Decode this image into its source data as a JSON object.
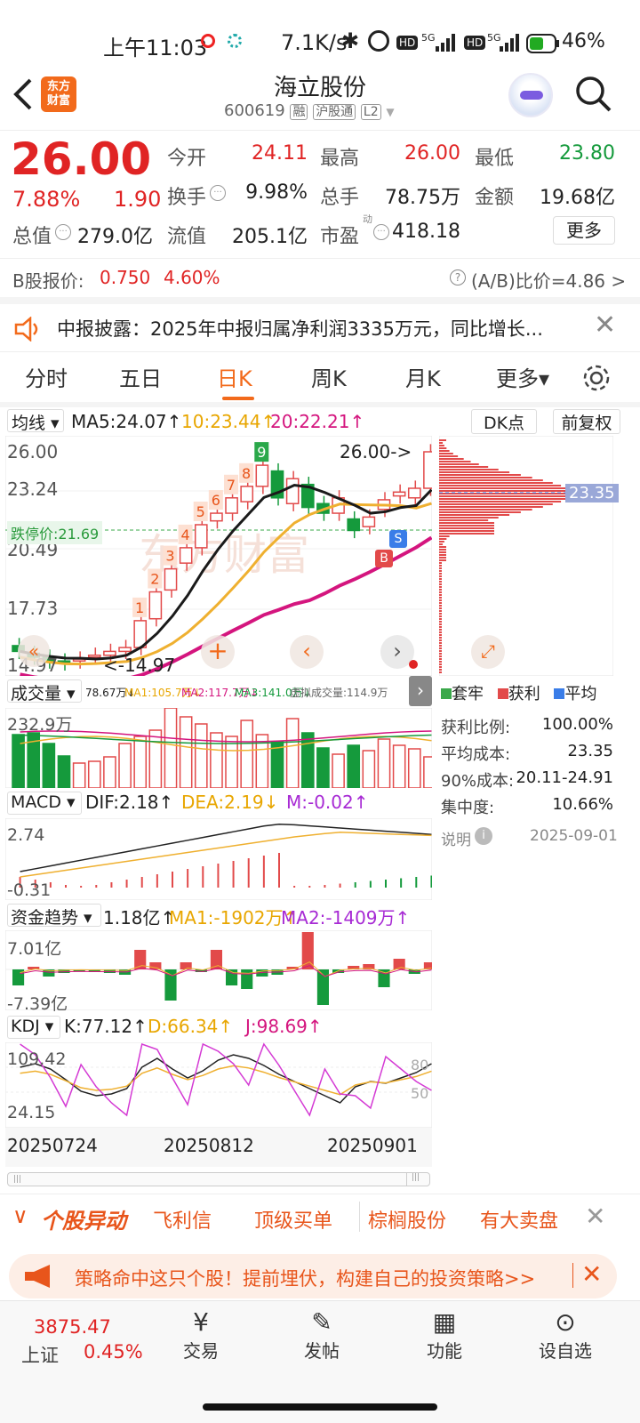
{
  "status": {
    "time": "上午11:03",
    "net": "7.1K/s",
    "battery": "46%",
    "sig1": "HD",
    "sig2": "HD",
    "fiveg": "5G"
  },
  "header": {
    "title": "海立股份",
    "code": "600619",
    "tag1": "融",
    "tag2": "沪股通",
    "tag3": "L2",
    "logo": "东方\n财富"
  },
  "quote": {
    "price": "26.00",
    "pct": "7.88%",
    "chg": "1.90",
    "jk_l": "今开",
    "jk": "24.11",
    "zg_l": "最高",
    "zg": "26.00",
    "zd_l": "最低",
    "zd": "23.80",
    "hs_l": "换手",
    "hs": "9.98%",
    "zs_l": "总手",
    "zs": "78.75万",
    "je_l": "金额",
    "je": "19.68亿",
    "zz_l": "总值",
    "zz": "279.0亿",
    "lz_l": "流值",
    "lz": "205.1亿",
    "sy_l": "市盈",
    "sy_sup": "动",
    "sy": "418.18",
    "more": "更多"
  },
  "bshare": {
    "label": "B股报价:",
    "price": "0.750",
    "pct": "4.60%",
    "ratio": "(A/B)比价=4.86 >"
  },
  "notice": {
    "text": "中报披露：2025年中报归属净利润3335万元，同比增长..."
  },
  "tabs": [
    "分时",
    "五日",
    "日K",
    "周K",
    "月K",
    "更多▾"
  ],
  "kline": {
    "ma_label": "均线 ▾",
    "ma5": "MA5:24.07↑",
    "ma10": "10:23.44↑",
    "ma20": "20:22.21↑",
    "dk": "DK点",
    "fq": "前复权",
    "y1": "26.00",
    "y2": "23.24",
    "y3": "20.49",
    "y4": "17.73",
    "y5": "14.97",
    "limit": "跌停价:21.69",
    "hi_lbl": "26.00->",
    "lo_lbl": "<-14.97",
    "watermark": "东方财富",
    "nums": [
      "1",
      "2",
      "3",
      "4",
      "5",
      "6",
      "7",
      "8",
      "9"
    ],
    "b": "B",
    "s": "S"
  },
  "chips": {
    "price": "23.35",
    "leg1": "套牢",
    "leg2": "获利",
    "leg3": "平均",
    "r1l": "获利比例:",
    "r1": "100.00%",
    "r2l": "平均成本:",
    "r2": "23.35",
    "r3l": "90%成本:",
    "r3": "20.11-24.91",
    "r4l": "集中度:",
    "r4": "10.66%",
    "note": "说明",
    "date": "2025-09-01"
  },
  "volume": {
    "label": "成交量 ▾",
    "v": "78.67万↓",
    "ma1": "MA1:105.7万↓",
    "ma2": "MA2:117.7万↓",
    "ma3": "MA3:141.0万↓",
    "virt": "虚拟成交量:114.9万",
    "ymax": "232.9万"
  },
  "macd": {
    "label": "MACD ▾",
    "dif": "DIF:2.18↑",
    "dea": "DEA:2.19↓",
    "m": "M:-0.02↑",
    "ymax": "2.74",
    "ymin": "-0.31"
  },
  "fund": {
    "label": "资金趋势 ▾",
    "v": "1.18亿↑",
    "ma1": "MA1:-1902万↑",
    "ma2": "MA2:-1409万↑",
    "ymax": "7.01亿",
    "ymin": "-7.39亿"
  },
  "kdj": {
    "label": "KDJ ▾",
    "k": "K:77.12↑",
    "d": "D:66.34↑",
    "j": "J:98.69↑",
    "ymax": "109.42",
    "ymin": "24.15",
    "g80": "80",
    "g50": "50"
  },
  "dates": [
    "20250724",
    "20250812",
    "20250901"
  ],
  "feed": {
    "title": "个股异动",
    "items": [
      "飞利信",
      "顶级买单",
      "棕榈股份",
      "有大卖盘"
    ]
  },
  "promo": {
    "text": "策略命中这只个股！提前埋伏，构建自己的投资策略>>"
  },
  "nav": {
    "index": "3875.47",
    "index_name": "上证",
    "index_pct": "0.45%",
    "items": [
      "交易",
      "发帖",
      "功能",
      "设自选"
    ]
  }
}
